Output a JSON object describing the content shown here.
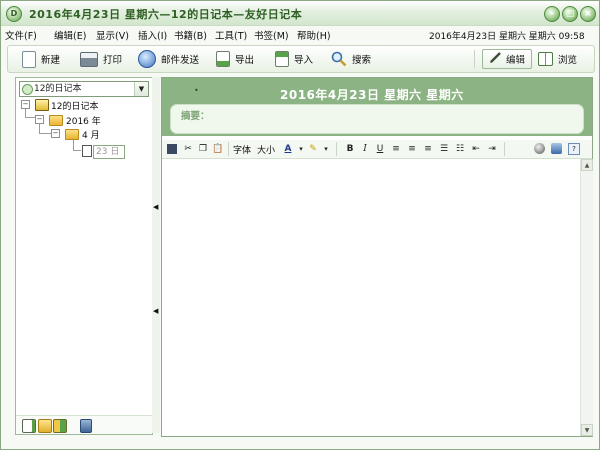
{
  "window": {
    "title": "2016年4月23日  星期六—12的日记本—友好日记本",
    "logo_glyph": "D",
    "controls": {
      "minimize": "–",
      "maximize": "□",
      "close": "×"
    }
  },
  "menu": {
    "items": [
      "文件(F)",
      "编辑(E)",
      "显示(V)",
      "插入(I)",
      "书籍(B)",
      "工具(T)",
      "书签(M)",
      "帮助(H)"
    ],
    "datetime": "2016年4月23日  星期六  星期六  09:58"
  },
  "toolbar": {
    "new_label": "新建",
    "print_label": "打印",
    "mail_label": "邮件发送",
    "export_label": "导出",
    "import_label": "导入",
    "search_label": "搜索",
    "edit_label": "编辑",
    "browse_label": "浏览"
  },
  "tree": {
    "selector_value": "12的日记本",
    "root": "12的日记本",
    "year": "2016 年",
    "month": "4 月",
    "day": "23 日",
    "expanders": {
      "root": "−",
      "year": "−",
      "month": "−"
    }
  },
  "splitter": {
    "arrow": "◀"
  },
  "header": {
    "dot": "•",
    "date": "2016年4月23日  星期六     星期六",
    "summary_label": "摘要："
  },
  "format_toolbar": {
    "font_label": "字体",
    "size_label": "大小",
    "font_color_glyph": "A",
    "bold": "B",
    "italic": "I",
    "underline": "U",
    "dropdown_glyph": "▾"
  },
  "scrollbar": {
    "up": "▲",
    "down": "▼"
  },
  "colors": {
    "accent_green": "#8bb383",
    "title_green": "#2e5f23",
    "summary_bg": "#f0f7ec"
  }
}
